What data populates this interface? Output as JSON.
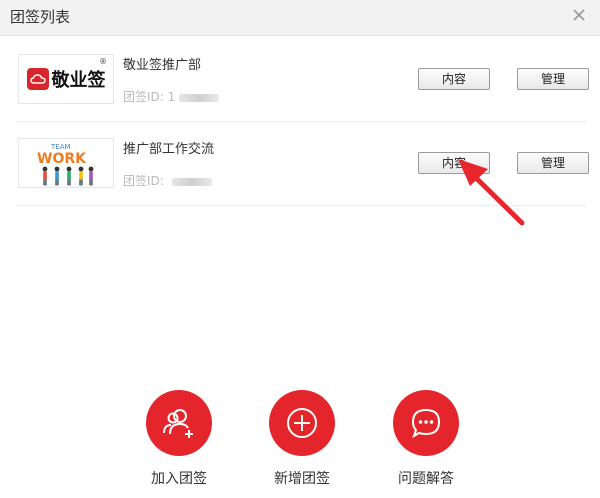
{
  "window": {
    "title": "团签列表",
    "close_icon": "close-icon"
  },
  "groups": [
    {
      "name": "敬业签推广部",
      "id_label": "团签ID:",
      "id_value": "1",
      "logo_text": "敬业签",
      "logo_reg": "®"
    },
    {
      "name": "推广部工作交流",
      "id_label": "团签ID:",
      "id_value": "",
      "logo_line1": "TEAM",
      "logo_line2": "WORK"
    }
  ],
  "buttons": {
    "content": "内容",
    "manage": "管理"
  },
  "actions": [
    {
      "label": "加入团签",
      "icon": "add-user-icon"
    },
    {
      "label": "新增团签",
      "icon": "plus-circle-icon"
    },
    {
      "label": "问题解答",
      "icon": "chat-bubble-icon"
    }
  ],
  "colors": {
    "accent": "#e4262c",
    "arrow": "#e8262b"
  }
}
